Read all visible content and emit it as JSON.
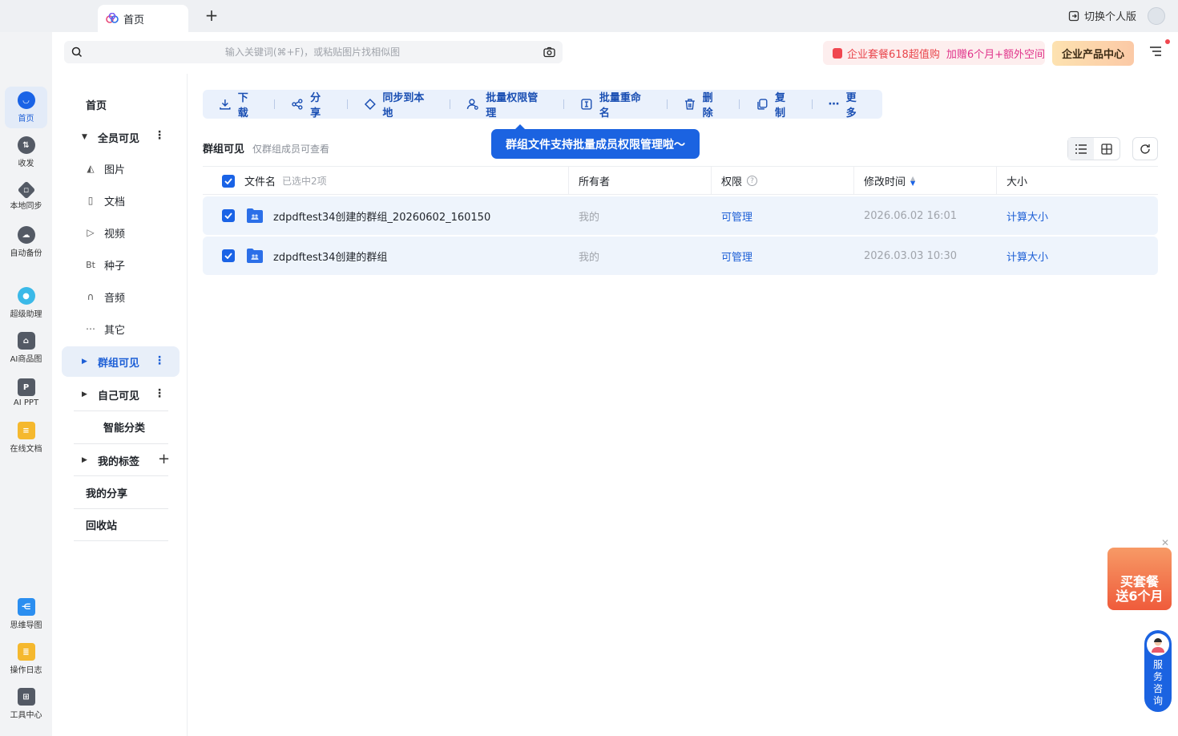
{
  "tabbar": {
    "tab_label": "首页",
    "switch_label": "切换个人版"
  },
  "leftnav": {
    "items": [
      {
        "label": "首页",
        "icon": "home-icon"
      },
      {
        "label": "收发",
        "icon": "transfer-icon"
      },
      {
        "label": "本地同步",
        "icon": "sync-icon"
      },
      {
        "label": "自动备份",
        "icon": "backup-icon"
      },
      {
        "label": "超级助理",
        "icon": "assistant-icon"
      },
      {
        "label": "AI商品图",
        "icon": "ai-product-icon"
      },
      {
        "label": "AI PPT",
        "icon": "ai-ppt-icon"
      },
      {
        "label": "在线文档",
        "icon": "online-doc-icon"
      },
      {
        "label": "思维导图",
        "icon": "mindmap-icon"
      },
      {
        "label": "操作日志",
        "icon": "log-icon"
      },
      {
        "label": "工具中心",
        "icon": "tools-icon"
      }
    ]
  },
  "header": {
    "search_placeholder": "输入关键词(⌘+F)，或粘贴图片找相似图",
    "promo_text_1": "企业套餐618超值购",
    "promo_text_2": "加赠6个月+额外空间",
    "product_center": "企业产品中心"
  },
  "sidebar": {
    "home": "首页",
    "all_visible": "全员可见",
    "sub_items": [
      {
        "label": "图片",
        "icon": "image-icon"
      },
      {
        "label": "文档",
        "icon": "document-icon"
      },
      {
        "label": "视频",
        "icon": "video-icon"
      },
      {
        "label": "种子",
        "icon": "torrent-icon"
      },
      {
        "label": "音频",
        "icon": "audio-icon"
      },
      {
        "label": "其它",
        "icon": "more-dots-icon"
      }
    ],
    "group_visible": "群组可见",
    "self_visible": "自己可见",
    "smart_classify": "智能分类",
    "my_tags": "我的标签",
    "my_share": "我的分享",
    "recycle_bin": "回收站"
  },
  "toolbar": {
    "download": "下载",
    "share": "分享",
    "sync_local": "同步到本地",
    "batch_permission": "批量权限管理",
    "batch_rename": "批量重命名",
    "delete": "删除",
    "copy": "复制",
    "more": "更多"
  },
  "tooltip": "群组文件支持批量成员权限管理啦～",
  "crumb": {
    "title": "群组可见",
    "desc": "仅群组成员可查看"
  },
  "table": {
    "columns": {
      "name": "文件名",
      "selected": "已选中2项",
      "owner": "所有者",
      "permission": "权限",
      "modified": "修改时间",
      "size": "大小"
    },
    "rows": [
      {
        "name": "zdpdftest34创建的群组_20260602_160150",
        "owner": "我的",
        "permission": "可管理",
        "modified": "2026.06.02 16:01",
        "size": "计算大小"
      },
      {
        "name": "zdpdftest34创建的群组",
        "owner": "我的",
        "permission": "可管理",
        "modified": "2026.03.03 10:30",
        "size": "计算大小"
      }
    ]
  },
  "floats": {
    "promo_line1": "买套餐",
    "promo_line2": "送6个月",
    "service": [
      "服",
      "务",
      "咨",
      "询"
    ]
  },
  "colors": {
    "accent": "#1a63e6",
    "promo_red": "#e9454b",
    "selected_row": "#eef4fc"
  }
}
